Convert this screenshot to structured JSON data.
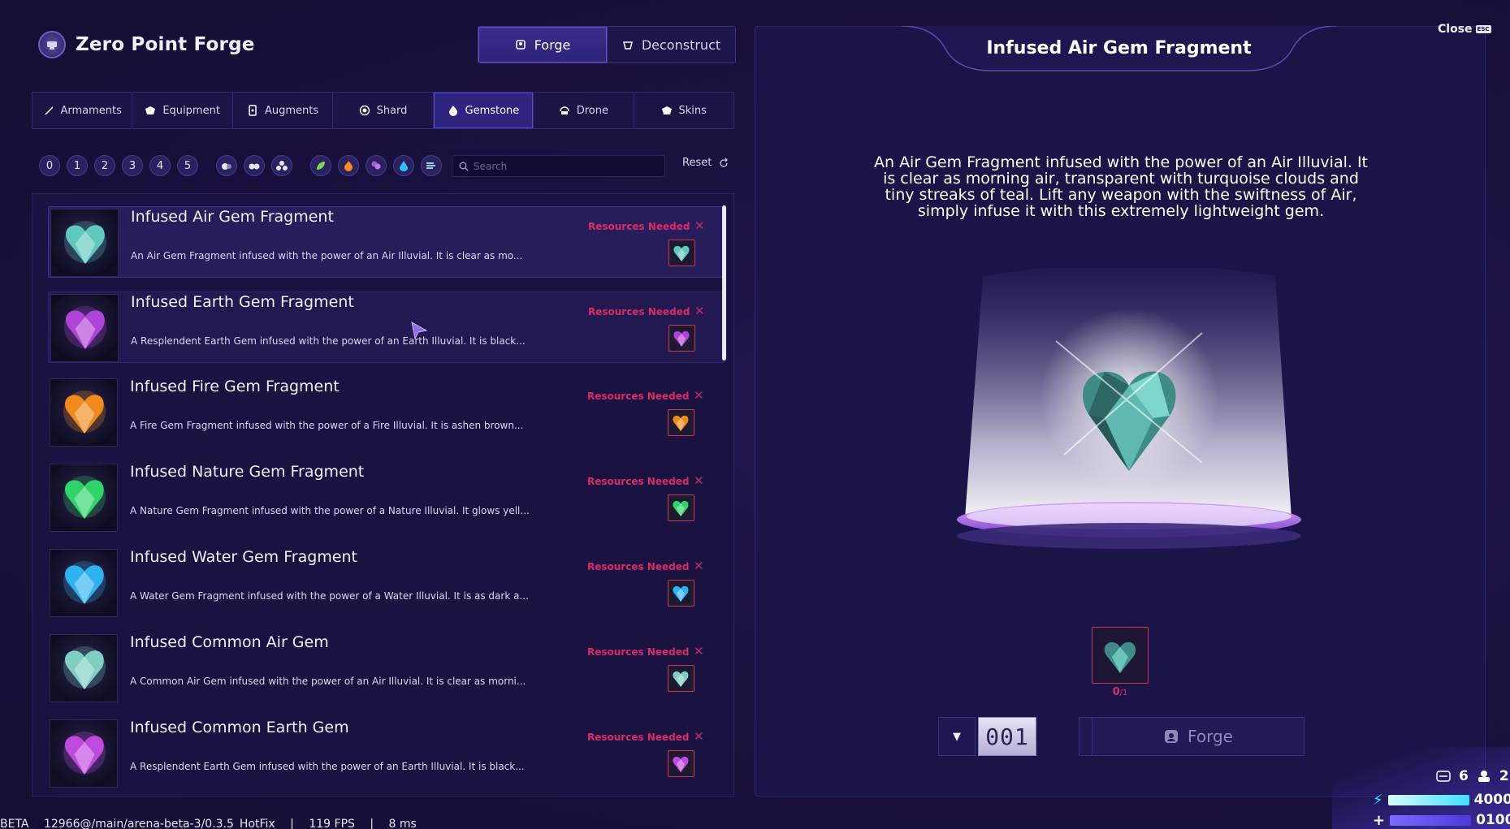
{
  "header": {
    "app_title": "Zero Point Forge",
    "mode_tabs": [
      {
        "label": "Forge",
        "icon": "forge-icon",
        "active": true
      },
      {
        "label": "Deconstruct",
        "icon": "deconstruct-icon",
        "active": false
      }
    ]
  },
  "categories": [
    {
      "label": "Armaments",
      "icon": "armaments-icon",
      "active": false
    },
    {
      "label": "Equipment",
      "icon": "equipment-icon",
      "active": false
    },
    {
      "label": "Augments",
      "icon": "augments-icon",
      "active": false
    },
    {
      "label": "Shard",
      "icon": "shard-icon",
      "active": false
    },
    {
      "label": "Gemstone",
      "icon": "gemstone-icon",
      "active": true
    },
    {
      "label": "Drone",
      "icon": "drone-icon",
      "active": false
    },
    {
      "label": "Skins",
      "icon": "skins-icon",
      "active": false
    }
  ],
  "filters": {
    "tiers": [
      "0",
      "1",
      "2",
      "3",
      "4",
      "5"
    ],
    "sizes": [
      "one-dot-icon",
      "two-dots-icon",
      "three-dots-icon"
    ],
    "elements": [
      "nature-icon",
      "fire-icon",
      "earth-icon",
      "water-icon",
      "air-icon"
    ],
    "search_placeholder": "Search",
    "reset_label": "Reset"
  },
  "items": [
    {
      "title": "Infused Air Gem Fragment",
      "desc": "An Air Gem Fragment infused with the power of an Air Illuvial. It is clear as mo...",
      "status": "Resources Needed",
      "color": "#5fc9bf"
    },
    {
      "title": "Infused Earth Gem Fragment",
      "desc": "A Resplendent Earth Gem infused with the power of an Earth Illuvial. It is black...",
      "status": "Resources Needed",
      "color": "#b144d8"
    },
    {
      "title": "Infused Fire Gem Fragment",
      "desc": "A Fire Gem Fragment infused with the power of a Fire Illuvial. It is ashen brown...",
      "status": "Resources Needed",
      "color": "#f08a1c"
    },
    {
      "title": "Infused Nature Gem Fragment",
      "desc": "A Nature Gem Fragment infused with the power of a Nature Illuvial. It glows yell...",
      "status": "Resources Needed",
      "color": "#2fd46a"
    },
    {
      "title": "Infused Water Gem Fragment",
      "desc": "A Water Gem Fragment infused with the power of a Water Illuvial. It is as dark a...",
      "status": "Resources Needed",
      "color": "#2fb3f0"
    },
    {
      "title": "Infused Common Air Gem",
      "desc": "A Common Air Gem infused with the power of an Air Illuvial. It is clear as morni...",
      "status": "Resources Needed",
      "color": "#7fcfc4"
    },
    {
      "title": "Infused Common Earth Gem",
      "desc": "A Resplendent Earth Gem infused with the power of an Earth Illuvial. It is black...",
      "status": "Resources Needed",
      "color": "#c04ae0"
    }
  ],
  "detail": {
    "title": "Infused Air Gem Fragment",
    "close_label": "Close",
    "close_key": "ESC",
    "description": "An Air Gem Fragment infused with the power of an Air Illuvial. It is clear as morning air, transparent with turquoise clouds and tiny streaks of teal. Lift any weapon with the swiftness of Air, simply infuse it with this extremely lightweight gem.",
    "required_have": "0",
    "required_need": "/1",
    "quantity": "001",
    "forge_label": "Forge"
  },
  "stats": {
    "tokens": "6",
    "crew": "2",
    "energy": "4000",
    "health": "0100"
  },
  "footer": {
    "beta": "BETA",
    "build": "12966@/main/arena-beta-3/0.3.5_HotFix",
    "sep1": "|",
    "fps": "119 FPS",
    "sep2": "|",
    "latency": "8 ms"
  }
}
